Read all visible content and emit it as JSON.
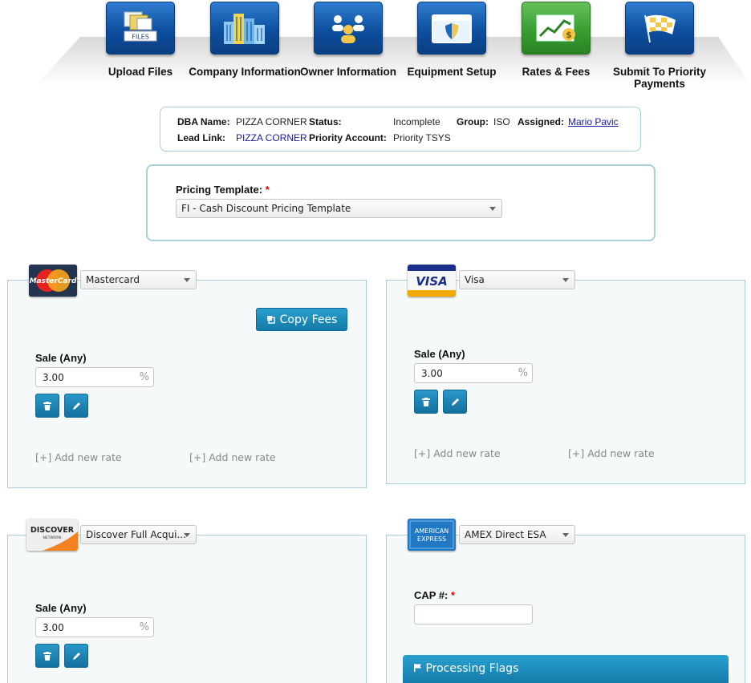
{
  "wizard": {
    "steps": [
      {
        "label": "Upload Files",
        "icon": "files-icon",
        "tile_text": "FILES"
      },
      {
        "label": "Company Information",
        "icon": "buildings-icon"
      },
      {
        "label": "Owner Information",
        "icon": "people-icon"
      },
      {
        "label": "Equipment Setup",
        "icon": "browser-shield-icon"
      },
      {
        "label": "Rates & Fees",
        "icon": "chart-dollar-icon",
        "active": true
      },
      {
        "label": "Submit To Priority Payments",
        "icon": "checkered-flag-icon"
      }
    ],
    "active_color": "#379e2f",
    "tile_color": "#0d4f9e"
  },
  "summary": {
    "dba_label": "DBA Name:",
    "dba_value": "PIZZA CORNER",
    "status_label": "Status:",
    "status_value": "Incomplete",
    "group_label": "Group:",
    "group_value": "ISO",
    "assigned_label": "Assigned:",
    "assigned_value": "Mario Pavic",
    "lead_label": "Lead Link:",
    "lead_value": "PIZZA CORNER",
    "priority_label": "Priority Account:",
    "priority_value": "Priority TSYS"
  },
  "pricing": {
    "label": "Pricing Template:",
    "required": "*",
    "value": "FI - Cash Discount Pricing Template"
  },
  "cards": {
    "mastercard": {
      "logo_text": "MasterCard",
      "select_value": "Mastercard",
      "copy_label": "Copy Fees",
      "sale_label": "Sale (Any)",
      "sale_value": "3.00",
      "pct": "%",
      "add_rate_1": "[+] Add new rate",
      "add_rate_2": "[+] Add new rate"
    },
    "visa": {
      "logo_text": "VISA",
      "select_value": "Visa",
      "sale_label": "Sale (Any)",
      "sale_value": "3.00",
      "pct": "%",
      "add_rate_1": "[+] Add new rate",
      "add_rate_2": "[+] Add new rate"
    },
    "discover": {
      "logo_text": "DISCOVER",
      "logo_sub": "NETWORK",
      "select_value": "Discover Full Acqui...",
      "sale_label": "Sale (Any)",
      "sale_value": "3.00",
      "pct": "%"
    },
    "amex": {
      "logo_text_1": "AMERICAN",
      "logo_text_2": "EXPRESS",
      "select_value": "AMEX Direct ESA",
      "cap_label": "CAP #:",
      "required": "*",
      "cap_value": "",
      "flags_label": "Processing Flags"
    }
  }
}
